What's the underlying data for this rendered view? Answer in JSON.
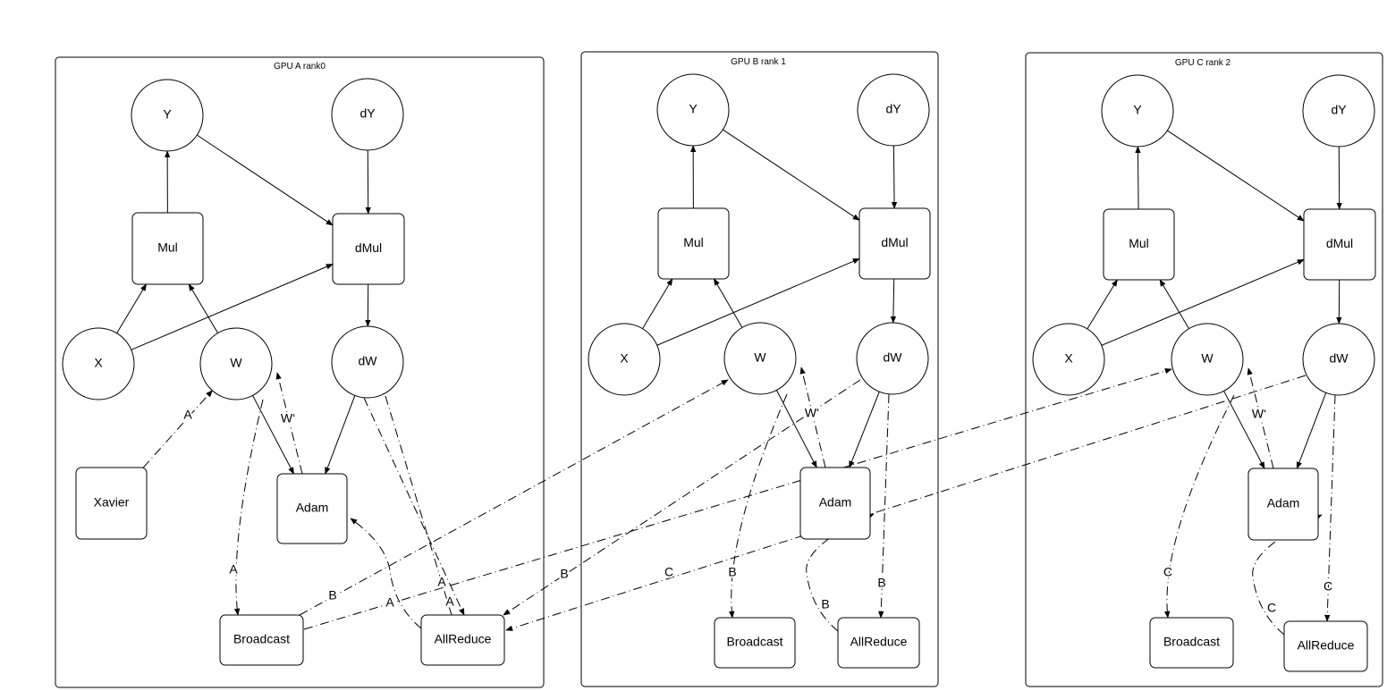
{
  "panels": [
    {
      "title": "GPU A rank0",
      "nodes": {
        "Y": "Y",
        "dY": "dY",
        "Mul": "Mul",
        "dMul": "dMul",
        "X": "X",
        "W": "W",
        "dW": "dW",
        "Xavier": "Xavier",
        "Adam": "Adam",
        "Broadcast": "Broadcast",
        "AllReduce": "AllReduce"
      },
      "edge_labels": {
        "xavier_to_w": "A",
        "adam_to_w": "W‘",
        "w_to_broadcast": "A",
        "dw_to_allreduce": "A",
        "dw_to_allreduce_2": "A",
        "allreduce_to_adam": "A"
      }
    },
    {
      "title": "GPU B rank 1",
      "nodes": {
        "Y": "Y",
        "dY": "dY",
        "Mul": "Mul",
        "dMul": "dMul",
        "X": "X",
        "W": "W",
        "dW": "dW",
        "Adam": "Adam",
        "Broadcast": "Broadcast",
        "AllReduce": "AllReduce"
      },
      "edge_labels": {
        "adam_to_w": "W‘",
        "w_to_broadcast": "B",
        "dw_to_allreduce": "B",
        "allreduce_to_adam": "B"
      }
    },
    {
      "title": "GPU C rank 2",
      "nodes": {
        "Y": "Y",
        "dY": "dY",
        "Mul": "Mul",
        "dMul": "dMul",
        "X": "X",
        "W": "W",
        "dW": "dW",
        "Adam": "Adam",
        "Broadcast": "Broadcast",
        "AllReduce": "AllReduce"
      },
      "edge_labels": {
        "adam_to_w": "W‘",
        "w_to_broadcast": "C",
        "dw_to_allreduce": "C",
        "allreduce_to_adam": "C"
      }
    }
  ],
  "cross_edge_labels": {
    "broadcast_a_to_w_b": "B",
    "dw_b_to_allreduce_a": "B",
    "dw_c_to_allreduce_a": "C"
  }
}
